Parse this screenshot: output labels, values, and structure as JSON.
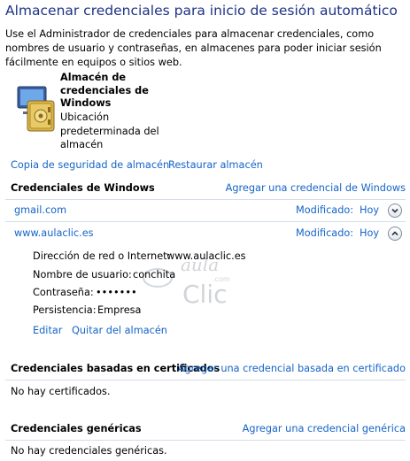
{
  "header": {
    "title": "Almacenar credenciales para inicio de sesión automático",
    "description": "Use el Administrador de credenciales para almacenar credenciales, como nombres de usuario y contraseñas, en almacenes para poder iniciar sesión fácilmente en equipos o sitios web."
  },
  "vault": {
    "icon": "credential-vault-icon",
    "title": "Almacén de credenciales de Windows",
    "subtitle": "Ubicación predeterminada del almacén"
  },
  "actions": {
    "backup": "Copia de seguridad de almacén",
    "restore": "Restaurar almacén"
  },
  "windows_credentials": {
    "heading": "Credenciales de Windows",
    "add_link": "Agregar una credencial de Windows",
    "items": [
      {
        "name": "gmail.com",
        "modified_label": "Modificado:",
        "modified_value": "Hoy",
        "expanded": false
      },
      {
        "name": "www.aulaclic.es",
        "modified_label": "Modificado:",
        "modified_value": "Hoy",
        "expanded": true
      }
    ],
    "details": {
      "address_label": "Dirección de red o Internet:",
      "address_value": "www.aulaclic.es",
      "user_label": "Nombre de usuario:",
      "user_value": "conchita",
      "password_label": "Contraseña:",
      "password_value": "•••••••",
      "persistence_label": "Persistencia:",
      "persistence_value": "Empresa",
      "edit": "Editar",
      "remove": "Quitar del almacén"
    }
  },
  "certificate_credentials": {
    "heading": "Credenciales basadas en certificados",
    "add_link": "Agregar una credencial basada en certificado",
    "empty": "No hay certificados."
  },
  "generic_credentials": {
    "heading": "Credenciales genéricas",
    "add_link": "Agregar una credencial genérica",
    "empty": "No hay credenciales genéricas."
  },
  "watermark": {
    "text_top": "aula",
    "text_bottom": "Clic",
    "text_small": ".com"
  },
  "colors": {
    "title": "#1e3287",
    "link": "#1464c8",
    "separator": "#d5dde8"
  }
}
